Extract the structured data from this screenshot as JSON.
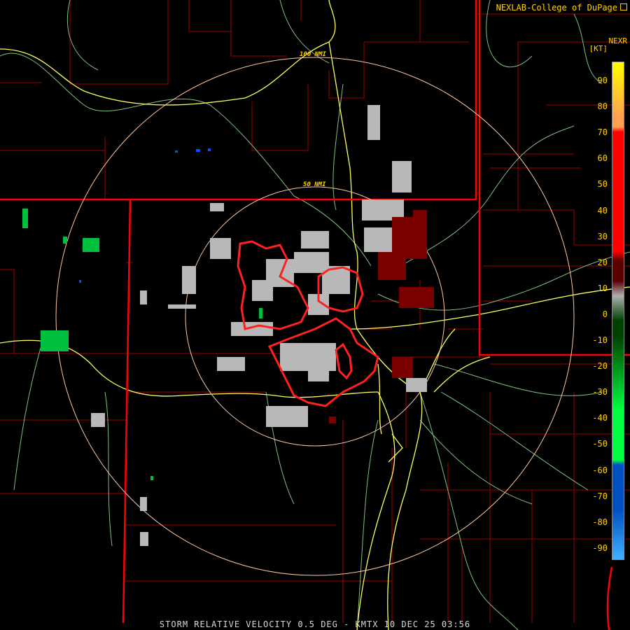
{
  "credit": "NEXLAB-College of DuPage",
  "credit_icon": "external-link-icon",
  "product_code": "NEXR",
  "unit_label": "[KT]",
  "footer_text": "STORM RELATIVE VELOCITY 0.5 DEG - KMTX 10 DEC 25 03:56",
  "range_rings": [
    {
      "label": "50 NMI",
      "range_nmi": 50
    },
    {
      "label": "100 NMI",
      "range_nmi": 100
    }
  ],
  "velocity_scale": {
    "ticks": [
      "90",
      "80",
      "70",
      "60",
      "50",
      "40",
      "30",
      "20",
      "10",
      "0",
      "-10",
      "-20",
      "-30",
      "-40",
      "-50",
      "-60",
      "-70",
      "-80",
      "-90"
    ],
    "colors": {
      "top_yellow": "#ffff00",
      "orange": "#ffa050",
      "red": "#ff0000",
      "dark_red": "#5a0000",
      "gray": "#b0b0b0",
      "dark_green": "#004000",
      "green": "#00ff40",
      "blue": "#0050c0",
      "light_blue": "#40b0ff"
    }
  },
  "map_colors": {
    "state_border": "#ff0000",
    "county_line": "#a00000",
    "highway": "#ffff60",
    "road": "#80c080",
    "range_ring": "#ffc8a0",
    "warning_polygon": "#ff2020"
  }
}
